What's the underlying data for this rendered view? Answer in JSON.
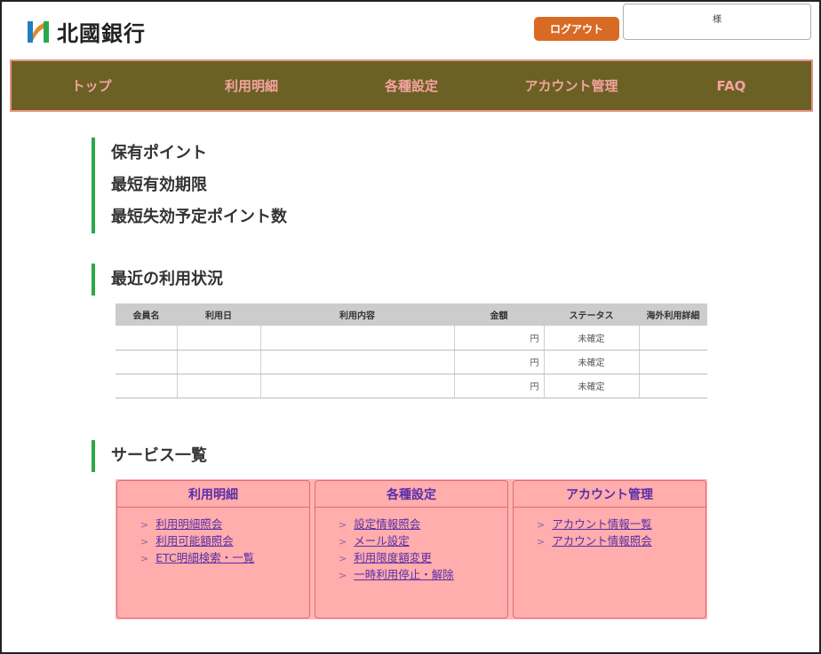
{
  "header": {
    "bank_name": "北國銀行",
    "logout_label": "ログアウト",
    "user_suffix": "様"
  },
  "nav": {
    "items": [
      "トップ",
      "利用明細",
      "各種設定",
      "アカウント管理",
      "FAQ"
    ]
  },
  "points": {
    "lines": [
      "保有ポイント",
      "最短有効期限",
      "最短失効予定ポイント数"
    ]
  },
  "recent": {
    "title": "最近の利用状況",
    "columns": [
      "会員名",
      "利用日",
      "利用内容",
      "金額",
      "ステータス",
      "海外利用詳細"
    ],
    "rows": [
      {
        "member": "",
        "date": "",
        "content": "",
        "amount": "円",
        "status": "未確定",
        "overseas": ""
      },
      {
        "member": "",
        "date": "",
        "content": "",
        "amount": "円",
        "status": "未確定",
        "overseas": ""
      },
      {
        "member": "",
        "date": "",
        "content": "",
        "amount": "円",
        "status": "未確定",
        "overseas": ""
      }
    ]
  },
  "services": {
    "title": "サービス一覧",
    "cards": [
      {
        "title": "利用明細",
        "links": [
          "利用明細照会",
          "利用可能額照会",
          "ETC明細検索・一覧"
        ]
      },
      {
        "title": "各種設定",
        "links": [
          "設定情報照会",
          "メール設定",
          "利用限度額変更",
          "一時利用停止・解除"
        ]
      },
      {
        "title": "アカウント管理",
        "links": [
          "アカウント情報一覧",
          "アカウント情報照会"
        ]
      }
    ],
    "arrow_glyph": ">"
  },
  "colors": {
    "nav_bg": "#6b6124",
    "nav_text": "#f5a3a0",
    "accent_bar": "#2aa84a",
    "logout_bg": "#d86a23",
    "service_bg": "#ffadad",
    "link": "#5a2ea6"
  }
}
